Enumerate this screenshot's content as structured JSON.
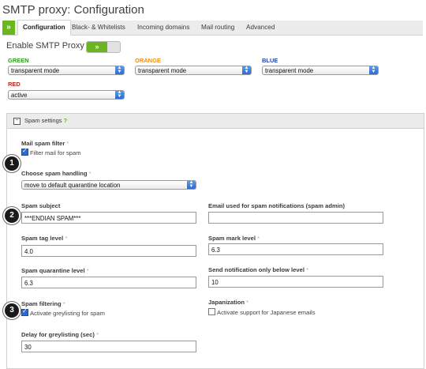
{
  "title": "SMTP proxy: Configuration",
  "tabs": [
    "Configuration",
    "Black- & Whitelists",
    "Incoming domains",
    "Mail routing",
    "Advanced"
  ],
  "enable_label": "Enable SMTP Proxy",
  "toggle_symbol": "»",
  "zones": [
    {
      "name": "GREEN",
      "color": "#2e9a1e",
      "value": "transparent mode"
    },
    {
      "name": "ORANGE",
      "color": "#f0901a",
      "value": "transparent mode"
    },
    {
      "name": "BLUE",
      "color": "#2547a8",
      "value": "transparent mode"
    },
    {
      "name": "RED",
      "color": "#c0231c",
      "value": "active"
    }
  ],
  "spam_panel": {
    "title": "Spam settings",
    "help": "?",
    "mail_spam_filter_label": "Mail spam filter",
    "filter_mail_label": "Filter mail for spam",
    "choose_handling_label": "Choose spam handling",
    "handling_value": "move to default quarantine location",
    "spam_subject_label": "Spam subject",
    "spam_subject_value": "***ENDIAN SPAM***",
    "spam_admin_label": "Email used for spam notifications (spam admin)",
    "spam_admin_value": "",
    "tag_level_label": "Spam tag level",
    "tag_level_value": "4.0",
    "mark_level_label": "Spam mark level",
    "mark_level_value": "6.3",
    "quarantine_level_label": "Spam quarantine level",
    "quarantine_level_value": "6.3",
    "notify_below_label": "Send notification only below level",
    "notify_below_value": "10",
    "spam_filtering_label": "Spam filtering",
    "greylisting_label": "Activate greylisting for spam",
    "japanization_label": "Japanization",
    "japanese_label": "Activate support for Japanese emails",
    "delay_label": "Delay for greylisting (sec)",
    "delay_value": "30",
    "required_mark": "*"
  },
  "markers": [
    "1",
    "2",
    "3"
  ],
  "icons": {
    "tab_arrow": "»",
    "collapse": "minus-icon",
    "select_arrow": "updown-arrow-icon"
  }
}
